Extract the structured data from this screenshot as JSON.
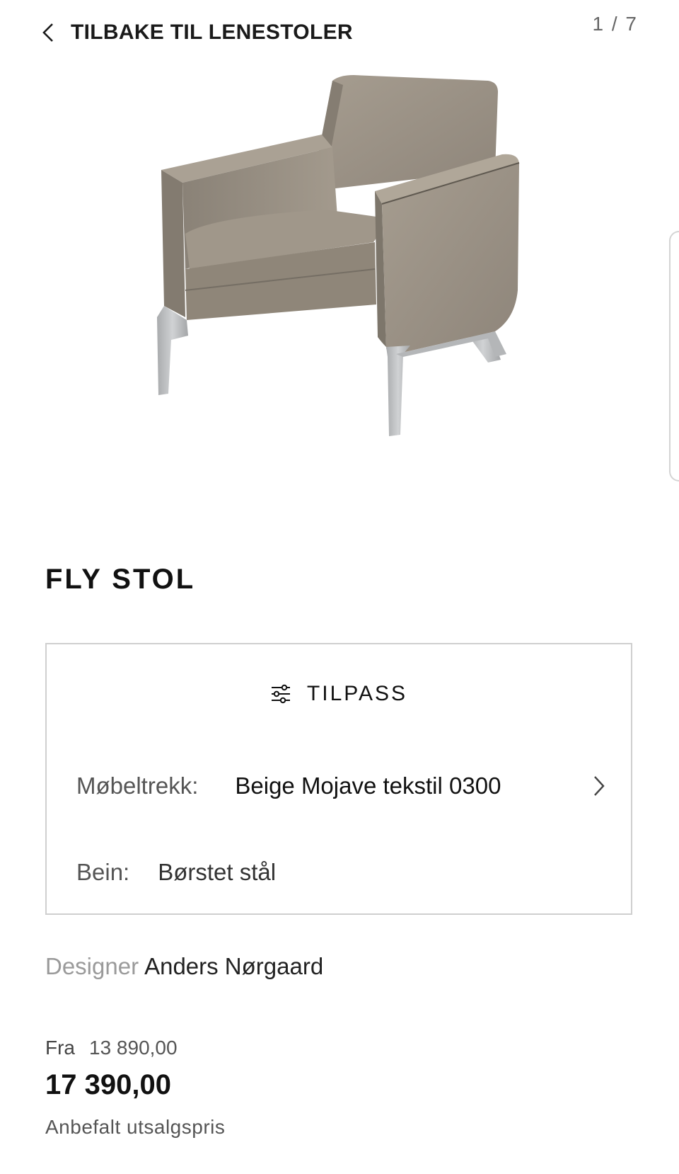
{
  "nav": {
    "back_label": "TILBAKE TIL LENESTOLER",
    "image_counter": "1 / 7"
  },
  "product": {
    "title": "FLY STOL",
    "image_colors": {
      "fabric": "#9b9184",
      "fabric_shadow": "#7e766b",
      "legs": "#b9bbbd"
    }
  },
  "config": {
    "customize_label": "TILPASS",
    "customize_icon": "sliders-icon",
    "options": [
      {
        "label": "Møbeltrekk:",
        "value": "Beige Mojave tekstil 0300"
      },
      {
        "label": "Bein:",
        "value": "Børstet stål"
      }
    ]
  },
  "designer": {
    "label": "Designer",
    "name": "Anders Nørgaard"
  },
  "price": {
    "from_label": "Fra",
    "from_value": "13 890,00",
    "current": "17 390,00",
    "note": "Anbefalt utsalgspris"
  }
}
